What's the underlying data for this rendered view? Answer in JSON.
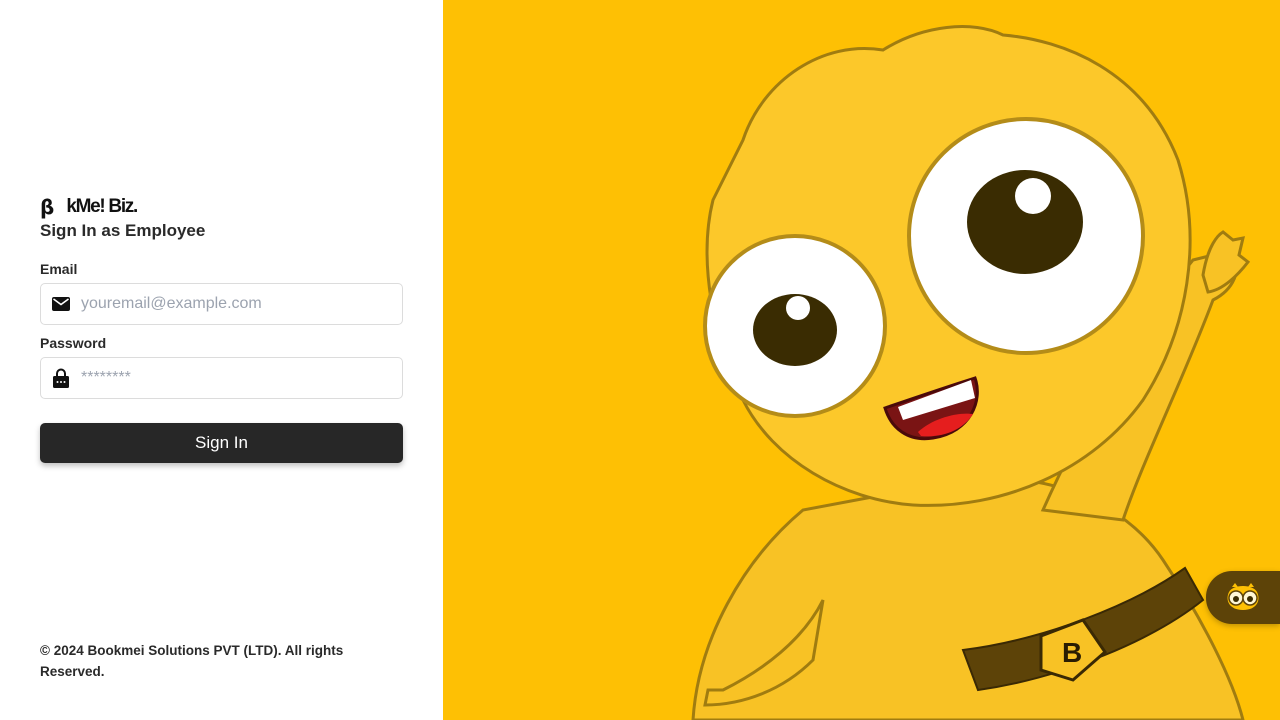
{
  "brand": {
    "logo_letter": "β",
    "logo_text": "kMe! Biz."
  },
  "form": {
    "title": "Sign In as Employee",
    "email_label": "Email",
    "email_placeholder": "youremail@example.com",
    "email_icon": "envelope-icon",
    "password_label": "Password",
    "password_placeholder": "********",
    "password_icon": "lock-icon",
    "submit_label": "Sign In"
  },
  "footer": {
    "copyright": "© 2024 Bookmei Solutions PVT (LTD). All rights Reserved."
  },
  "mascot": {
    "belt_badge_letter": "B"
  },
  "chat_widget": {
    "icon": "mascot-face-icon"
  },
  "colors": {
    "accent": "#fec004",
    "button": "#272727",
    "chat_bg": "#5d4308"
  }
}
